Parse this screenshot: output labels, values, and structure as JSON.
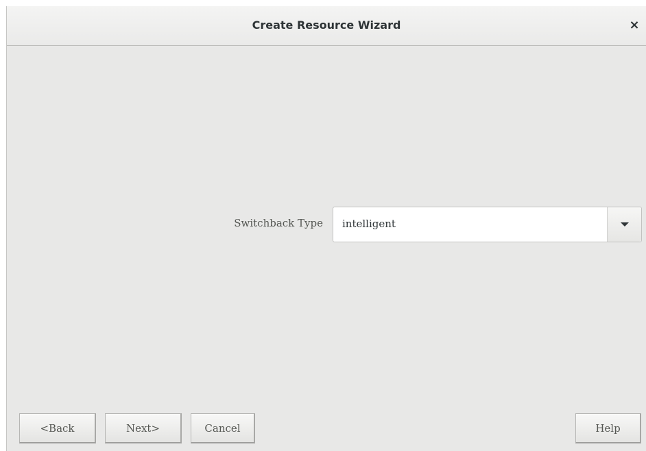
{
  "window": {
    "title": "Create Resource Wizard",
    "close_label": "×"
  },
  "form": {
    "switchback_label": "Switchback Type",
    "switchback_value": "intelligent"
  },
  "buttons": {
    "back": "<Back",
    "next": "Next>",
    "cancel": "Cancel",
    "help": "Help"
  },
  "icons": {
    "close": "close-icon",
    "dropdown": "chevron-down-icon"
  },
  "colors": {
    "background": "#e8e8e7",
    "input_background": "#ffffff",
    "text": "#2e3436"
  }
}
